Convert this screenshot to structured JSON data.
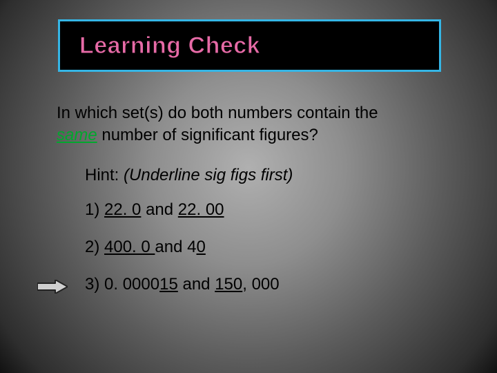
{
  "title": "Learning Check",
  "question": {
    "line1_a": "In which set(s) do both numbers contain the",
    "same_word": "same",
    "line2_b": " number of significant figures?"
  },
  "hint": {
    "label": "Hint: ",
    "paren": "(Underline sig figs first)"
  },
  "options": {
    "o1": {
      "n": "1)  ",
      "a": "22. 0",
      "mid": "  and ",
      "b": "22. 00"
    },
    "o2": {
      "n": "2)  ",
      "a": "400. 0 ",
      "mid": "and ",
      "b_pre": "4",
      "b_u": "0"
    },
    "o3": {
      "n": "3)  ",
      "a_pre": "0. 0000",
      "a_u": "15",
      "mid": " and ",
      "b_u": "150",
      "b_post": ", 000"
    }
  }
}
